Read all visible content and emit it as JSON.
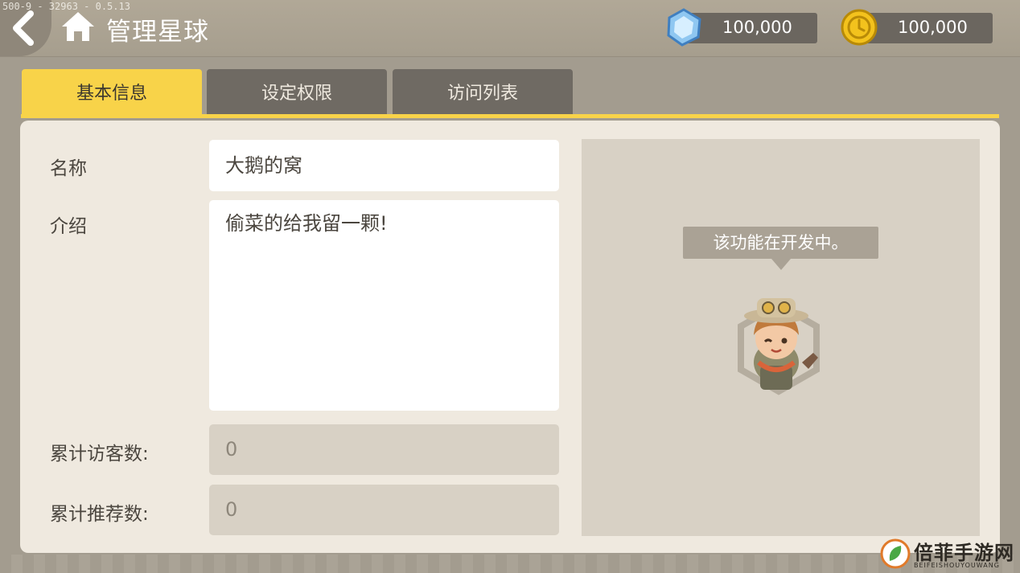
{
  "build_info": "500-9 - 32963 - 0.5.13",
  "header": {
    "title": "管理星球",
    "gems": "100,000",
    "coins": "100,000"
  },
  "tabs": [
    {
      "label": "基本信息",
      "active": true
    },
    {
      "label": "设定权限",
      "active": false
    },
    {
      "label": "访问列表",
      "active": false
    }
  ],
  "form": {
    "name_label": "名称",
    "name_value": "大鹅的窝",
    "intro_label": "介绍",
    "intro_value": "偷菜的给我留一颗!",
    "visits_label": "累计访客数:",
    "visits_value": "0",
    "recs_label": "累计推荐数:",
    "recs_value": "0"
  },
  "preview": {
    "message": "该功能在开发中。"
  },
  "watermark": {
    "name": "倍菲手游网",
    "sub": "BEIFEISHOUYOUWANG"
  },
  "colors": {
    "accent": "#f8d349",
    "tab_inactive": "#6f6a63",
    "panel": "#efe9df",
    "field_disabled": "#d8d1c5"
  },
  "icons": [
    "back-arrow-icon",
    "home-icon",
    "gem-icon",
    "coin-icon"
  ]
}
